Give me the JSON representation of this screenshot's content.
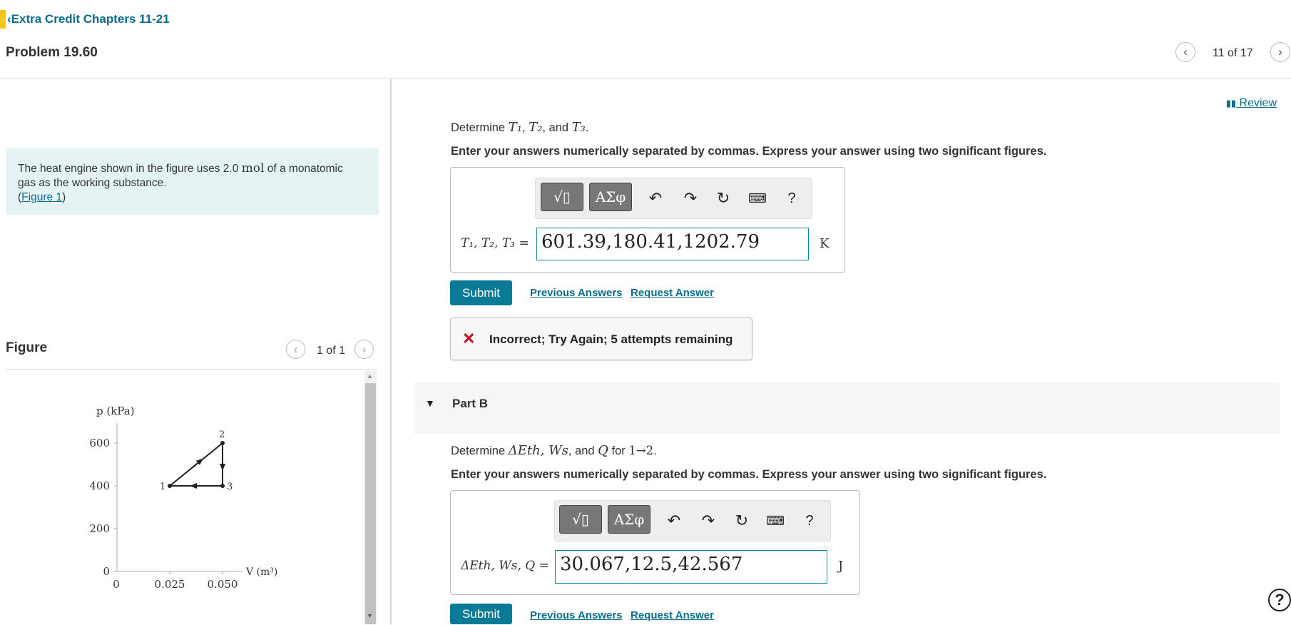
{
  "header": {
    "back_link": "Extra Credit Chapters 11-21",
    "problem_title": "Problem 19.60",
    "pager_text": "11 of 17",
    "review_label": "Review"
  },
  "left": {
    "info_line1": "The heat engine shown in the figure uses 2.0 ",
    "info_unit": "mol",
    "info_line1_end": " of a monatomic",
    "info_line2": "gas as the working substance.",
    "figure_link": "Figure 1",
    "figure_label": "Figure",
    "figure_pager": "1 of 1"
  },
  "graph": {
    "y_axis_label": "p (kPa)",
    "x_axis_label": "V (m³)",
    "y_ticks": [
      "600",
      "400",
      "200",
      "0"
    ],
    "x_ticks": [
      "0",
      "0.025",
      "0.050"
    ],
    "point_labels": [
      "1",
      "2",
      "3"
    ]
  },
  "part_a": {
    "question_prefix": "Determine ",
    "question_vars": [
      "T₁",
      "T₂",
      "T₃"
    ],
    "question_sep1": ", ",
    "question_and": ", and ",
    "question_end": ".",
    "instructions": "Enter your answers numerically separated by commas. Express your answer using two significant figures.",
    "var_label": "T₁, T₂, T₃ =",
    "answer_value": "601.39,180.41,1202.79",
    "unit": "K",
    "submit_label": "Submit",
    "previous_answers": "Previous Answers",
    "request_answer": "Request Answer",
    "feedback": "Incorrect; Try Again; 5 attempts remaining"
  },
  "part_b": {
    "title": "Part B",
    "question_prefix": "Determine ",
    "question_vars": "ΔEth, Ws",
    "question_and": ", and ",
    "question_q": "Q",
    "question_for": " for ",
    "question_process": "1→2",
    "question_end": ".",
    "instructions": "Enter your answers numerically separated by commas. Express your answer using two significant figures.",
    "var_label": "ΔEth, Ws, Q =",
    "answer_value": "30.067,12.5,42.567",
    "unit": "J",
    "submit_label": "Submit",
    "previous_answers": "Previous Answers",
    "request_answer": "Request Answer"
  },
  "toolbar": {
    "templates_label": "√▯",
    "greek_label": "ΑΣφ",
    "help_label": "?"
  },
  "colors": {
    "accent": "#f5c518",
    "link": "#0a6c8c",
    "submit": "#0a7a96",
    "error": "#d0021b",
    "info_bg": "#e5f3f5"
  }
}
